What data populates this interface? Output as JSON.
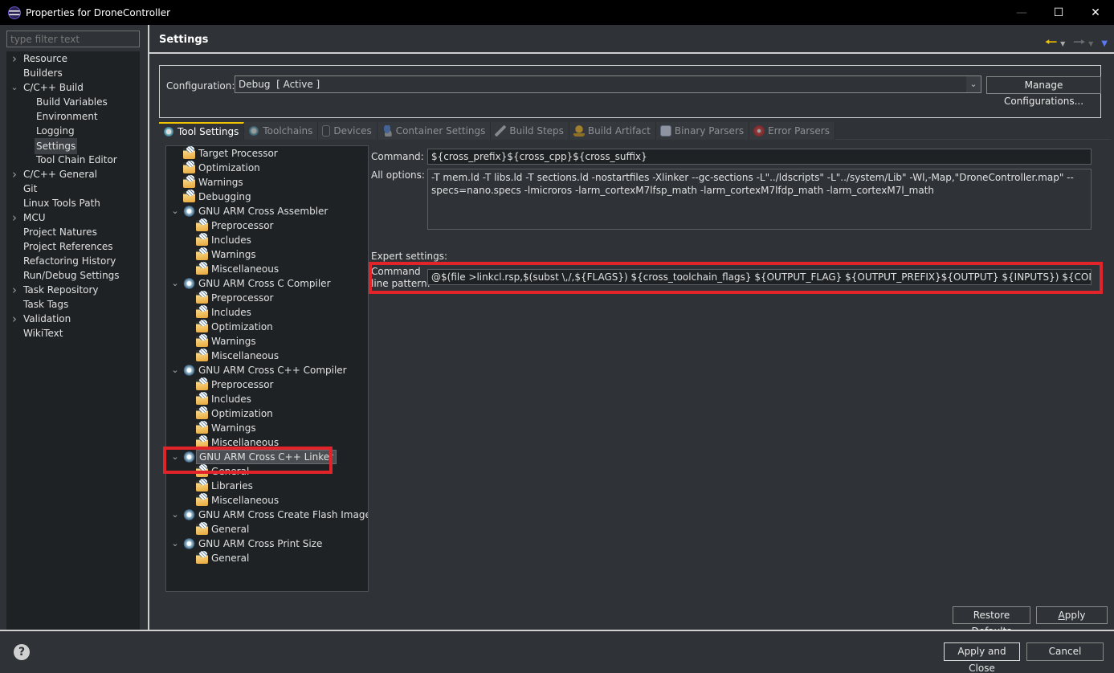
{
  "window": {
    "title": "Properties for DroneController",
    "controls": [
      "minimize",
      "maximize",
      "close"
    ]
  },
  "filter": {
    "placeholder": "type filter text",
    "value": ""
  },
  "nav": {
    "items": [
      {
        "label": "Resource",
        "level": 0,
        "expander": "collapsed"
      },
      {
        "label": "Builders",
        "level": 0,
        "expander": "none"
      },
      {
        "label": "C/C++ Build",
        "level": 0,
        "expander": "expanded"
      },
      {
        "label": "Build Variables",
        "level": 1,
        "expander": "none"
      },
      {
        "label": "Environment",
        "level": 1,
        "expander": "none"
      },
      {
        "label": "Logging",
        "level": 1,
        "expander": "none"
      },
      {
        "label": "Settings",
        "level": 1,
        "expander": "none",
        "selected": true
      },
      {
        "label": "Tool Chain Editor",
        "level": 1,
        "expander": "none"
      },
      {
        "label": "C/C++ General",
        "level": 0,
        "expander": "collapsed"
      },
      {
        "label": "Git",
        "level": 0,
        "expander": "none"
      },
      {
        "label": "Linux Tools Path",
        "level": 0,
        "expander": "none"
      },
      {
        "label": "MCU",
        "level": 0,
        "expander": "collapsed"
      },
      {
        "label": "Project Natures",
        "level": 0,
        "expander": "none"
      },
      {
        "label": "Project References",
        "level": 0,
        "expander": "none"
      },
      {
        "label": "Refactoring History",
        "level": 0,
        "expander": "none"
      },
      {
        "label": "Run/Debug Settings",
        "level": 0,
        "expander": "none"
      },
      {
        "label": "Task Repository",
        "level": 0,
        "expander": "collapsed"
      },
      {
        "label": "Task Tags",
        "level": 0,
        "expander": "none"
      },
      {
        "label": "Validation",
        "level": 0,
        "expander": "collapsed"
      },
      {
        "label": "WikiText",
        "level": 0,
        "expander": "none"
      }
    ]
  },
  "page": {
    "title": "Settings",
    "nav_icons": [
      "back-arrow-icon",
      "forward-arrow-icon",
      "view-menu-icon"
    ]
  },
  "configuration": {
    "label": "Configuration:",
    "value": "Debug  [ Active ]",
    "manage_label": "Manage Configurations..."
  },
  "tabs": [
    {
      "label": "Tool Settings",
      "icon": "tool-settings-icon",
      "active": true
    },
    {
      "label": "Toolchains",
      "icon": "toolchains-icon"
    },
    {
      "label": "Devices",
      "icon": "devices-icon"
    },
    {
      "label": "Container Settings",
      "icon": "container-settings-icon"
    },
    {
      "label": "Build Steps",
      "icon": "build-steps-icon"
    },
    {
      "label": "Build Artifact",
      "icon": "build-artifact-icon"
    },
    {
      "label": "Binary Parsers",
      "icon": "binary-parsers-icon"
    },
    {
      "label": "Error Parsers",
      "icon": "error-parsers-icon"
    }
  ],
  "tool_tree": [
    {
      "label": "Target Processor",
      "level": 1,
      "type": "option"
    },
    {
      "label": "Optimization",
      "level": 1,
      "type": "option"
    },
    {
      "label": "Warnings",
      "level": 1,
      "type": "option"
    },
    {
      "label": "Debugging",
      "level": 1,
      "type": "option"
    },
    {
      "label": "GNU ARM Cross Assembler",
      "level": 0,
      "type": "tool"
    },
    {
      "label": "Preprocessor",
      "level": 2,
      "type": "option"
    },
    {
      "label": "Includes",
      "level": 2,
      "type": "option"
    },
    {
      "label": "Warnings",
      "level": 2,
      "type": "option"
    },
    {
      "label": "Miscellaneous",
      "level": 2,
      "type": "option"
    },
    {
      "label": "GNU ARM Cross C Compiler",
      "level": 0,
      "type": "tool"
    },
    {
      "label": "Preprocessor",
      "level": 2,
      "type": "option"
    },
    {
      "label": "Includes",
      "level": 2,
      "type": "option"
    },
    {
      "label": "Optimization",
      "level": 2,
      "type": "option"
    },
    {
      "label": "Warnings",
      "level": 2,
      "type": "option"
    },
    {
      "label": "Miscellaneous",
      "level": 2,
      "type": "option"
    },
    {
      "label": "GNU ARM Cross C++ Compiler",
      "level": 0,
      "type": "tool"
    },
    {
      "label": "Preprocessor",
      "level": 2,
      "type": "option"
    },
    {
      "label": "Includes",
      "level": 2,
      "type": "option"
    },
    {
      "label": "Optimization",
      "level": 2,
      "type": "option"
    },
    {
      "label": "Warnings",
      "level": 2,
      "type": "option"
    },
    {
      "label": "Miscellaneous",
      "level": 2,
      "type": "option"
    },
    {
      "label": "GNU ARM Cross C++ Linker",
      "level": 0,
      "type": "tool",
      "selected": true
    },
    {
      "label": "General",
      "level": 2,
      "type": "option"
    },
    {
      "label": "Libraries",
      "level": 2,
      "type": "option"
    },
    {
      "label": "Miscellaneous",
      "level": 2,
      "type": "option"
    },
    {
      "label": "GNU ARM Cross Create Flash Image",
      "level": 0,
      "type": "tool"
    },
    {
      "label": "General",
      "level": 2,
      "type": "option"
    },
    {
      "label": "GNU ARM Cross Print Size",
      "level": 0,
      "type": "tool"
    },
    {
      "label": "General",
      "level": 2,
      "type": "option"
    }
  ],
  "details": {
    "command_label": "Command:",
    "command_value": "${cross_prefix}${cross_cpp}${cross_suffix}",
    "all_options_label": "All options:",
    "all_options_value": "-T mem.ld -T libs.ld -T sections.ld -nostartfiles -Xlinker --gc-sections -L\"../ldscripts\" -L\"../system/Lib\" -Wl,-Map,\"DroneController.map\" --specs=nano.specs -lmicroros -larm_cortexM7lfsp_math -larm_cortexM7lfdp_math -larm_cortexM7l_math",
    "expert_label": "Expert settings:",
    "pattern_label_line1": "Command",
    "pattern_label_line2": "line pattern:",
    "pattern_value": "@$(file >linkcl.rsp,$(subst \\,/,${FLAGS}) ${cross_toolchain_flags} ${OUTPUT_FLAG} ${OUTPUT_PREFIX}${OUTPUT} ${INPUTS}) ${COMMAND} @\"linkcl.rsp\""
  },
  "buttons": {
    "restore_pre": "Restore ",
    "restore_mn": "D",
    "restore_post": "efaults",
    "apply_mn": "A",
    "apply_post": "pply",
    "apply_close": "Apply and Close",
    "cancel": "Cancel"
  },
  "colors": {
    "highlight": "#e2232a",
    "active_tab_accent": "#f0c400",
    "back_arrow": "#f3c300",
    "view_menu": "#5a78f0"
  }
}
